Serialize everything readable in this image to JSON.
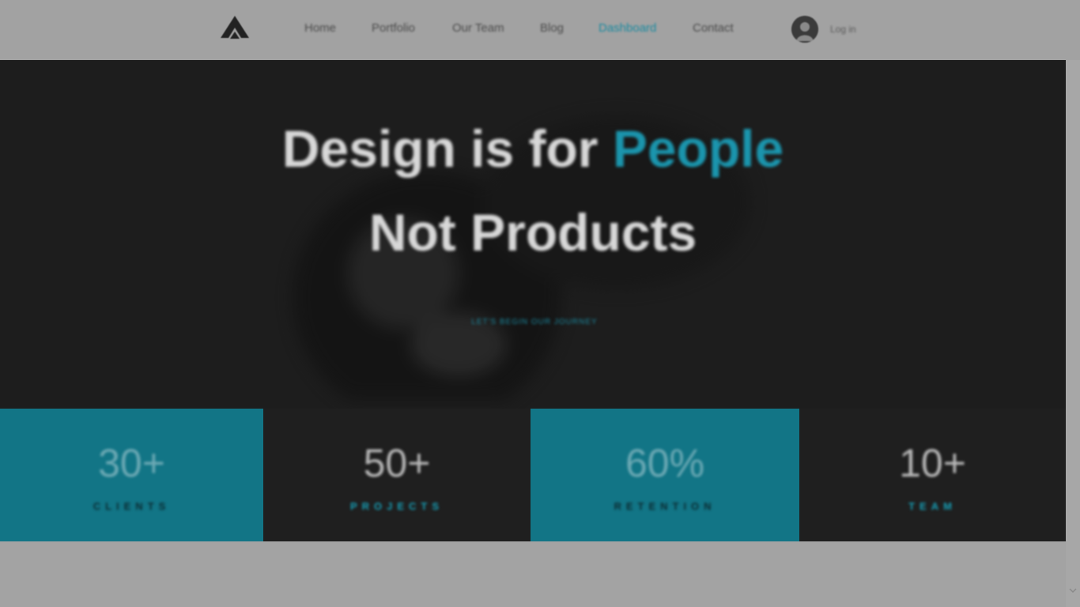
{
  "nav": {
    "logo_icon": "peak-logo-icon",
    "items": [
      {
        "label": "Home"
      },
      {
        "label": "Portfolio"
      },
      {
        "label": "Our Team"
      },
      {
        "label": "Blog"
      },
      {
        "label": "Dashboard"
      },
      {
        "label": "Contact"
      }
    ],
    "active_index": 4,
    "user_icon": "user-avatar-icon",
    "login_label": "Log in"
  },
  "hero": {
    "title_line1_prefix": "Design is for ",
    "title_line1_accent": "People",
    "title_line2": "Not Products",
    "cta_label": "LET'S BEGIN OUR JOURNEY"
  },
  "stats": [
    {
      "value": "30+",
      "label": "CLIENTS"
    },
    {
      "value": "50+",
      "label": "PROJECTS"
    },
    {
      "value": "60%",
      "label": "RETENTION"
    },
    {
      "value": "10+",
      "label": "TEAM"
    }
  ],
  "colors": {
    "accent": "#1b95ad",
    "teal_panel": "#127586",
    "dark_panel": "#1f1f1f",
    "overlay": "#a3a3a3"
  }
}
